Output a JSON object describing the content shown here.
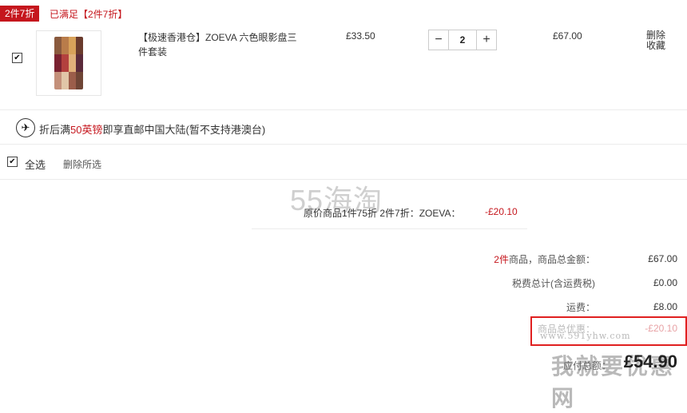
{
  "promo": {
    "tag": "2件7折",
    "status": "已满足【2件7折】"
  },
  "item": {
    "name": "【极速香港仓】ZOEVA 六色眼影盘三件套装",
    "unit_price": "£33.50",
    "qty_minus": "−",
    "quantity": "2",
    "qty_plus": "+",
    "line_total": "£67.00",
    "delete_label": "删除",
    "favorite_label": "收藏",
    "checked": "✔"
  },
  "shipping_note": {
    "prefix": "折后满",
    "amount": "50英镑",
    "suffix": "即享直邮中国大陆(暂不支持港澳台)",
    "icon": "✈"
  },
  "select_all": {
    "check": "✔",
    "label": "全选",
    "delete_selected": "删除所选"
  },
  "watermark": {
    "text": "55海淘",
    "url": "www.591yhw.com",
    "big": "我就要优惠网"
  },
  "discount": {
    "label": "原价商品1件75折 2件7折：ZOEVA：",
    "value": "-£20.10"
  },
  "summary": {
    "goods_count": "2件",
    "goods_label": "商品，商品总金额：",
    "goods_value": "£67.00",
    "tax_label": "税费总计(含运费税)",
    "tax_value": "£0.00",
    "shipping_label": "运费：",
    "shipping_value": "£8.00",
    "discount_label": "商品总优惠：",
    "discount_value": "-£20.10",
    "total_label": "应付总额：",
    "total_value": "£54.90"
  },
  "colors": {
    "accent": "#c5161d",
    "highlight_box": "#e02020"
  }
}
